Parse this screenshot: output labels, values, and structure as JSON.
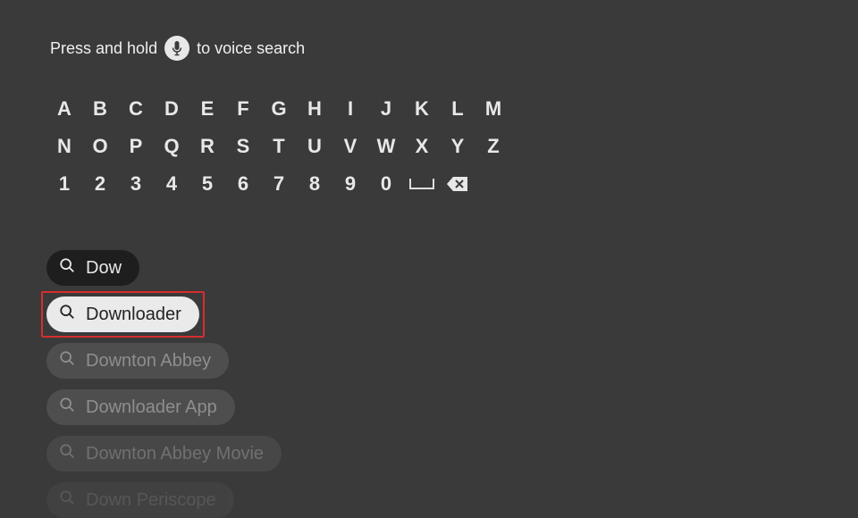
{
  "voice_hint": {
    "prefix": "Press and hold",
    "suffix": "to voice search"
  },
  "keyboard": {
    "row1": [
      "A",
      "B",
      "C",
      "D",
      "E",
      "F",
      "G",
      "H",
      "I",
      "J",
      "K",
      "L",
      "M"
    ],
    "row2": [
      "N",
      "O",
      "P",
      "Q",
      "R",
      "S",
      "T",
      "U",
      "V",
      "W",
      "X",
      "Y",
      "Z"
    ],
    "row3": [
      "1",
      "2",
      "3",
      "4",
      "5",
      "6",
      "7",
      "8",
      "9",
      "0"
    ]
  },
  "suggestions": {
    "typed": "Dow",
    "items": [
      {
        "label": "Downloader",
        "state": "selected"
      },
      {
        "label": "Downton Abbey",
        "state": "dim"
      },
      {
        "label": "Downloader App",
        "state": "dim"
      },
      {
        "label": "Downton Abbey Movie",
        "state": "dimmer"
      },
      {
        "label": "Down Periscope",
        "state": "faded"
      }
    ]
  }
}
